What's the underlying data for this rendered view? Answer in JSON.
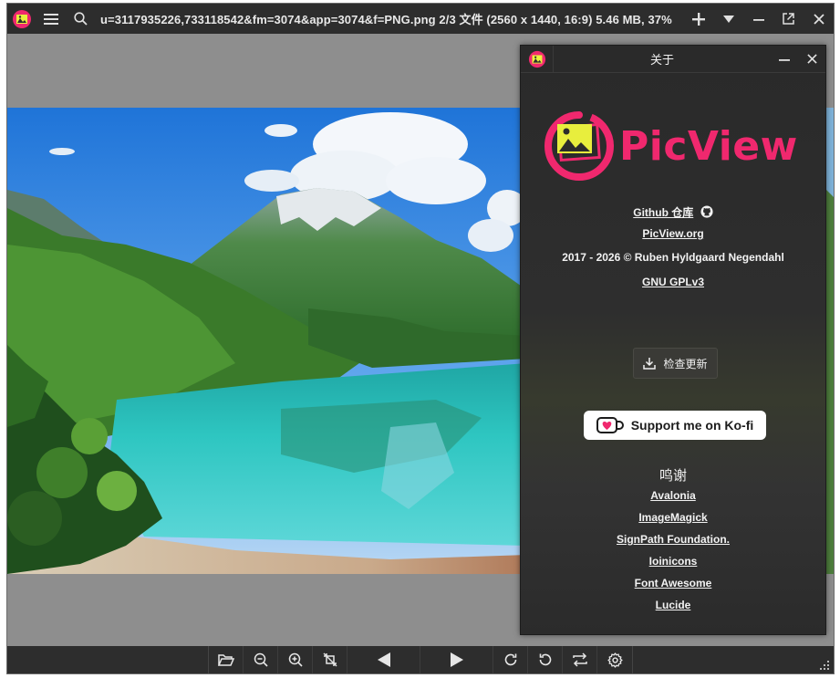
{
  "titlebar": {
    "title": "u=3117935226,733118542&fm=3074&app=3074&f=PNG.png 2/3 文件 (2560 x 1440, 16:9) 5.46 MB, 37%"
  },
  "about": {
    "title": "关于",
    "logo_text": "PicView",
    "github_label": "Github 仓库",
    "website_label": "PicView.org",
    "copyright": "2017 - 2026 © Ruben Hyldgaard Negendahl",
    "license_label": "GNU GPLv3",
    "check_update_label": "检查更新",
    "kofi_label": "Support me on Ko-fi",
    "thanks_title": "鸣谢",
    "credits": [
      "Avalonia",
      "ImageMagick",
      "SignPath Foundation.",
      "Ioinicons",
      "Font Awesome",
      "Lucide"
    ]
  },
  "colors": {
    "brand": "#f0286e",
    "chrome": "#2d2d2d",
    "canvas_bg": "#8e8e8e"
  },
  "icons": [
    "app-logo-icon",
    "menu-icon",
    "search-icon",
    "plus-icon",
    "chevron-down-icon",
    "minimize-icon",
    "external-window-icon",
    "close-icon",
    "folder-open-icon",
    "zoom-out-icon",
    "zoom-in-icon",
    "crop-off-icon",
    "previous-arrow-icon",
    "next-arrow-icon",
    "rotate-right-icon",
    "rotate-left-icon",
    "flip-icon",
    "gear-icon",
    "github-icon",
    "download-icon",
    "kofi-cup-icon"
  ]
}
